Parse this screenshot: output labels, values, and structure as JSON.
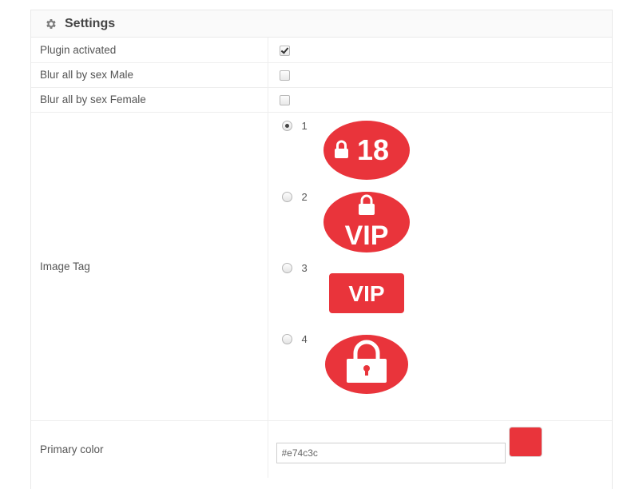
{
  "panel": {
    "title": "Settings",
    "icon": "gear-icon"
  },
  "rows": {
    "plugin_activated": {
      "label": "Plugin activated",
      "checked": true
    },
    "blur_male": {
      "label": "Blur all by sex Male",
      "checked": false
    },
    "blur_female": {
      "label": "Blur all by sex Female",
      "checked": false
    },
    "image_tag": {
      "label": "Image Tag",
      "selected": "1",
      "options": [
        {
          "value": "1",
          "image": "lock-18-badge-icon",
          "text": "18"
        },
        {
          "value": "2",
          "image": "lock-vip-circle-icon",
          "text": "VIP"
        },
        {
          "value": "3",
          "image": "vip-square-badge-icon",
          "text": "VIP"
        },
        {
          "value": "4",
          "image": "padlock-circle-icon"
        }
      ]
    },
    "primary_color": {
      "label": "Primary color",
      "value": "#e74c3c"
    }
  },
  "colors": {
    "accent": "#e9343b",
    "swatch": "#e9343b"
  }
}
